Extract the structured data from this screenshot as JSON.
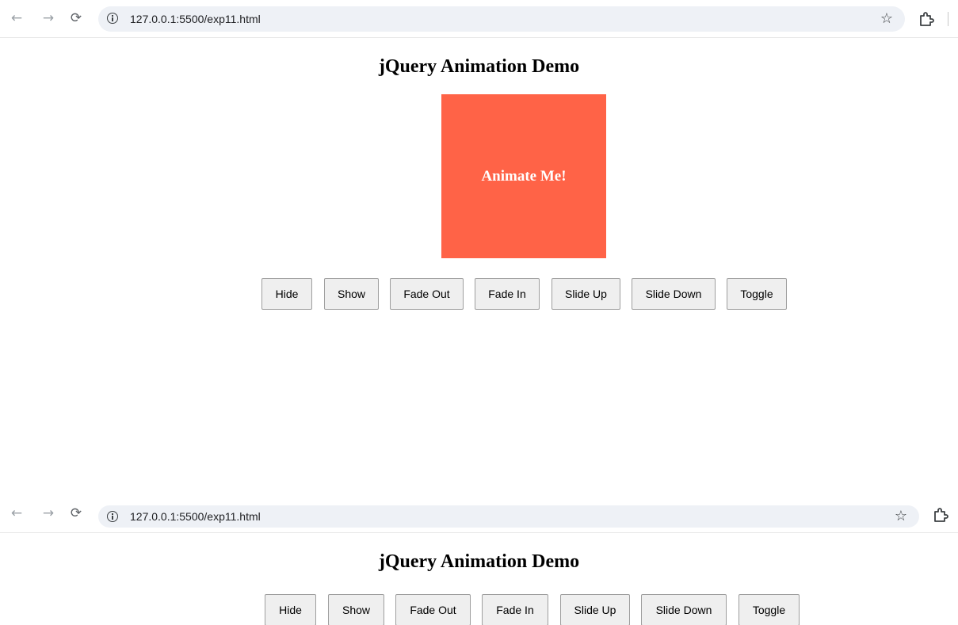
{
  "browser": {
    "url": "127.0.0.1:5500/exp11.html"
  },
  "page": {
    "title": "jQuery Animation Demo",
    "box_text": "Animate Me!"
  },
  "buttons": {
    "hide": "Hide",
    "show": "Show",
    "fade_out": "Fade Out",
    "fade_in": "Fade In",
    "slide_up": "Slide Up",
    "slide_down": "Slide Down",
    "toggle": "Toggle"
  },
  "icons": {
    "back": "arrow-left",
    "forward": "arrow-right",
    "reload": "reload",
    "site_info": "info-circle",
    "bookmark": "star-outline",
    "extensions": "puzzle-piece"
  },
  "colors": {
    "box_background": "#ff6347",
    "box_text": "#ffffff",
    "omnibox_background": "#eef1f6",
    "button_background": "#efefef"
  }
}
